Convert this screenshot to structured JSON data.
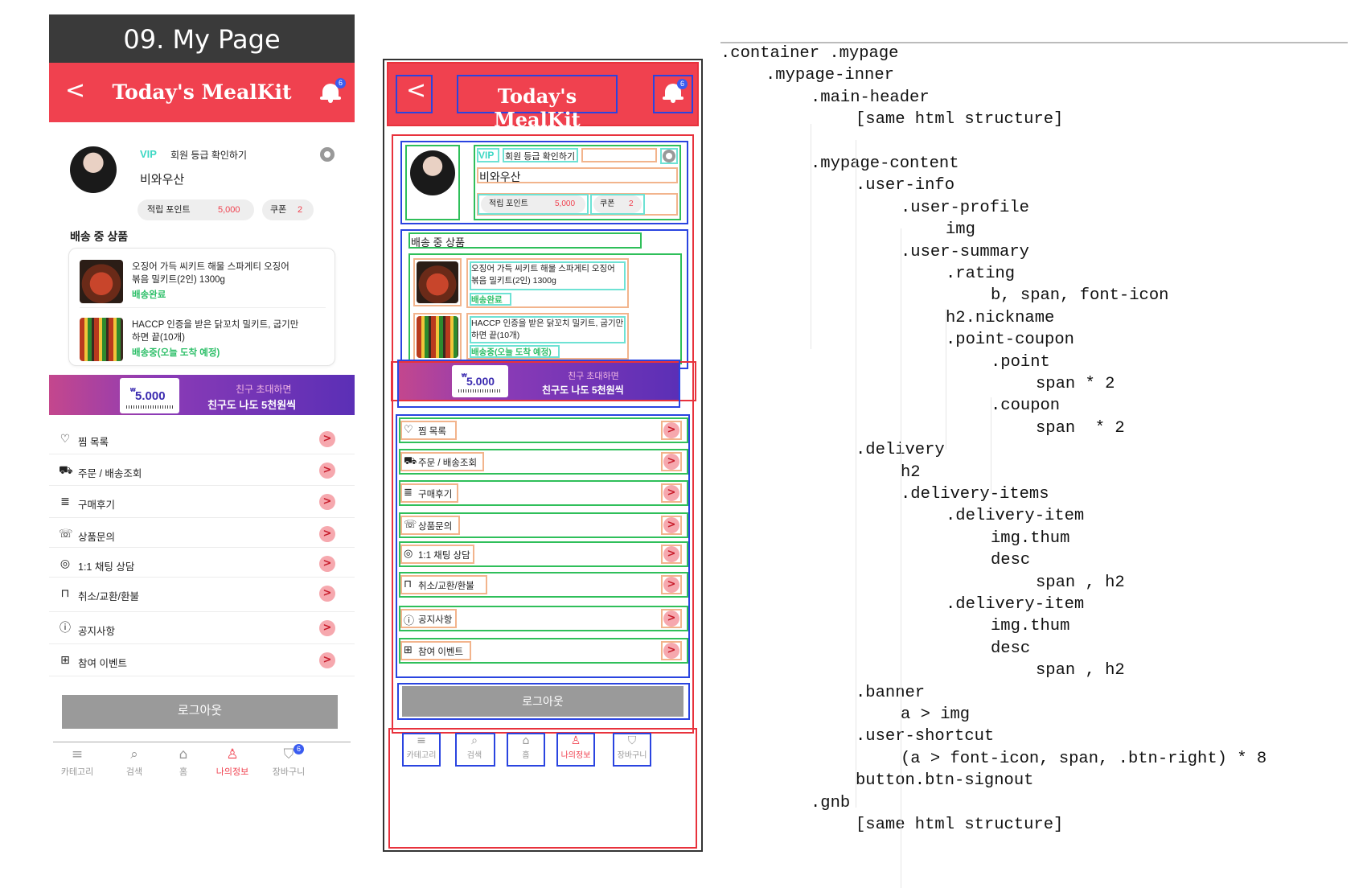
{
  "page_label": "09. My Page",
  "header": {
    "title": "Today's MealKit",
    "back": "<",
    "notification_count": "6"
  },
  "user": {
    "rating": "VIP",
    "rating_link": "회원 등급 확인하기",
    "nickname": "비와우산",
    "point_label": "적립 포인트",
    "point_value": "5,000",
    "coupon_label": "쿠폰",
    "coupon_value": "2"
  },
  "delivery": {
    "heading": "배송 중 상품",
    "items": [
      {
        "line1": "오징어 가득 씨키트 해물 스파게티 오징어",
        "line2": "볶음 밀키트(2인) 1300g",
        "status": "배송완료"
      },
      {
        "line1": "HACCP 인증을 받은 닭꼬치 밀키트, 굽기만",
        "line2": "하면 끝(10개)",
        "status": "배송중(오늘 도착 예정)"
      }
    ]
  },
  "banner": {
    "amount": "5.000",
    "currency": "₩",
    "line1": "친구 초대하면",
    "line2": "친구도 나도 5천원씩"
  },
  "shortcuts": [
    {
      "label": "찜 목록",
      "icon": "heart-icon",
      "glyph": "♡"
    },
    {
      "label": "주문 / 배송조회",
      "icon": "truck-icon",
      "glyph": "⛟"
    },
    {
      "label": "구매후기",
      "icon": "review-icon",
      "glyph": "≣"
    },
    {
      "label": "상품문의",
      "icon": "phone-icon",
      "glyph": "☏"
    },
    {
      "label": "1:1 채팅 상담",
      "icon": "headset-icon",
      "glyph": "◎"
    },
    {
      "label": "취소/교환/환불",
      "icon": "bag-icon",
      "glyph": "⊓"
    },
    {
      "label": "공지사항",
      "icon": "notice-icon",
      "glyph": "ⓘ"
    },
    {
      "label": "참여 이벤트",
      "icon": "gift-icon",
      "glyph": "⊞"
    }
  ],
  "logout": "로그아웃",
  "gnb": [
    {
      "label": "카테고리",
      "icon": "menu-icon",
      "glyph": "≡"
    },
    {
      "label": "검색",
      "icon": "search-icon",
      "glyph": "⌕"
    },
    {
      "label": "홈",
      "icon": "home-icon",
      "glyph": "⌂"
    },
    {
      "label": "나의정보",
      "icon": "user-icon",
      "glyph": "♙"
    },
    {
      "label": "장바구니",
      "icon": "cart-icon",
      "glyph": "⛉"
    }
  ],
  "code_lines": [
    {
      "indent": 0,
      "text": ".container .mypage"
    },
    {
      "indent": 1,
      "text": ".mypage-inner"
    },
    {
      "indent": 2,
      "text": ".main-header"
    },
    {
      "indent": 3,
      "text": "[same html structure]"
    },
    {
      "indent": 0,
      "text": ""
    },
    {
      "indent": 2,
      "text": ".mypage-content"
    },
    {
      "indent": 3,
      "text": ".user-info"
    },
    {
      "indent": 4,
      "text": ".user-profile"
    },
    {
      "indent": 5,
      "text": "img"
    },
    {
      "indent": 4,
      "text": ".user-summary"
    },
    {
      "indent": 5,
      "text": ".rating"
    },
    {
      "indent": 6,
      "text": "b, span, font-icon"
    },
    {
      "indent": 5,
      "text": "h2.nickname"
    },
    {
      "indent": 5,
      "text": ".point-coupon"
    },
    {
      "indent": 6,
      "text": ".point"
    },
    {
      "indent": 7,
      "text": "span * 2"
    },
    {
      "indent": 6,
      "text": ".coupon"
    },
    {
      "indent": 7,
      "text": "span  * 2"
    },
    {
      "indent": 3,
      "text": ".delivery"
    },
    {
      "indent": 4,
      "text": "h2"
    },
    {
      "indent": 4,
      "text": ".delivery-items"
    },
    {
      "indent": 5,
      "text": ".delivery-item"
    },
    {
      "indent": 6,
      "text": "img.thum"
    },
    {
      "indent": 6,
      "text": "desc"
    },
    {
      "indent": 7,
      "text": "span , h2"
    },
    {
      "indent": 5,
      "text": ".delivery-item"
    },
    {
      "indent": 6,
      "text": "img.thum"
    },
    {
      "indent": 6,
      "text": "desc"
    },
    {
      "indent": 7,
      "text": "span , h2"
    },
    {
      "indent": 3,
      "text": ".banner"
    },
    {
      "indent": 4,
      "text": "a > img"
    },
    {
      "indent": 3,
      "text": ".user-shortcut"
    },
    {
      "indent": 4,
      "text": "(a > font-icon, span, .btn-right) * 8"
    },
    {
      "indent": 3,
      "text": "button.btn-signout"
    },
    {
      "indent": 2,
      "text": ".gnb"
    },
    {
      "indent": 3,
      "text": "[same html structure]"
    }
  ]
}
